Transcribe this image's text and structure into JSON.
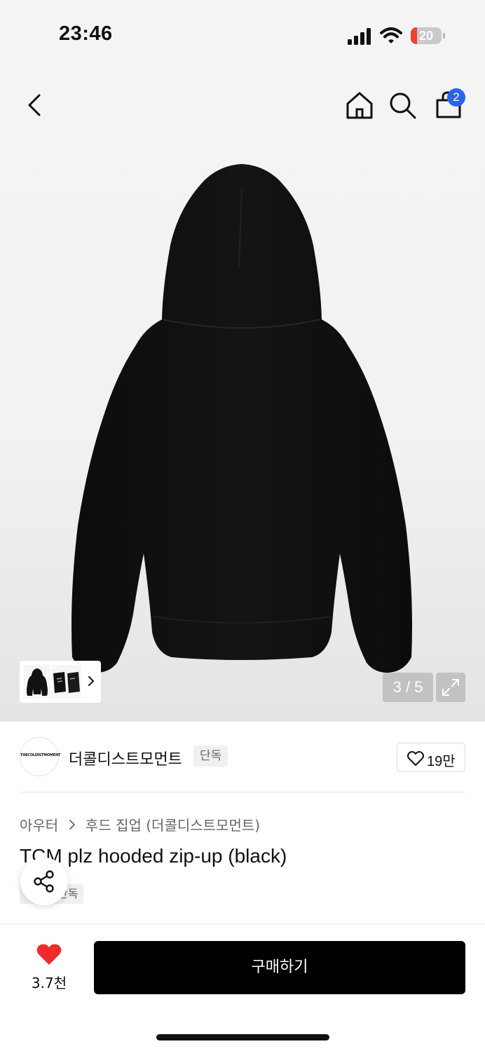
{
  "status_bar": {
    "time": "23:46",
    "battery_level": "20",
    "battery_fraction": 0.2,
    "battery_color": "#eb4436",
    "icons": [
      "cellular-signal-icon",
      "wifi-icon",
      "battery-icon"
    ]
  },
  "top_nav": {
    "icons": [
      "back-icon",
      "home-icon",
      "search-icon",
      "shopping-bag-icon"
    ],
    "cart_count": "2",
    "badge_color": "#2b63f0"
  },
  "gallery": {
    "counter": "3 / 5",
    "current": 3,
    "total": 5,
    "thumbnail_strip_icon": "chevron-right-icon",
    "expand_icon": "expand-icon"
  },
  "brand": {
    "logo_text": "THECOLDISTMOMENT",
    "name": "더콜디스트모먼트",
    "badge": "단독",
    "like_count": "19만",
    "like_icon": "heart-outline-icon"
  },
  "product": {
    "breadcrumb": [
      "아우터",
      "후드 집업 (더콜디스트모먼트)"
    ],
    "title": "TCM plz hooded zip-up (black)",
    "tag": "단독"
  },
  "bottom_bar": {
    "wish_count": "3.7천",
    "wish_icon": "heart-filled-icon",
    "wish_color": "#f02b2b",
    "buy_label": "구매하기"
  },
  "share_icon": "share-icon"
}
